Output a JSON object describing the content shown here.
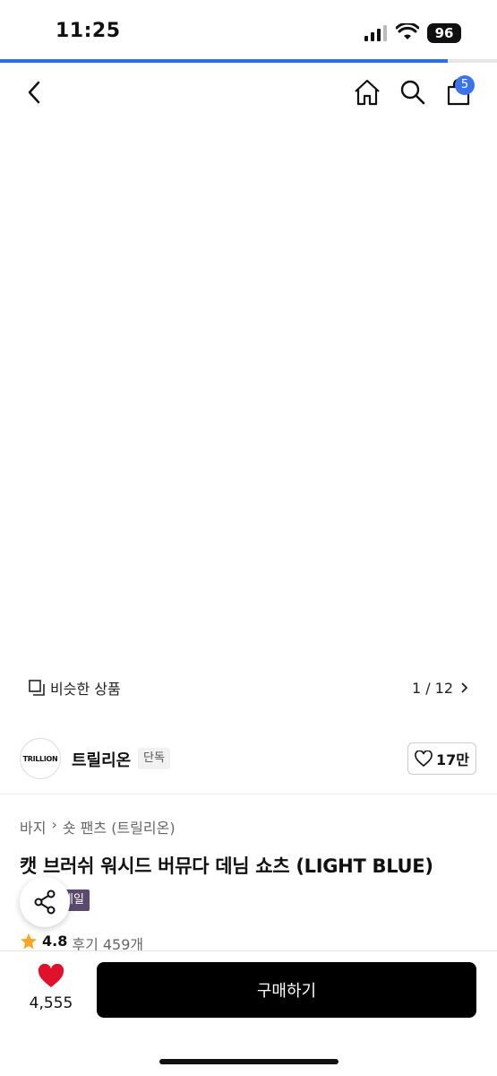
{
  "status_bar": {
    "time": "11:25",
    "battery": "96"
  },
  "load_progress": 0.9,
  "cart": {
    "count": "5"
  },
  "image": {
    "similar_label": "비슷한 상품",
    "counter": "1 / 12"
  },
  "brand": {
    "logo_text": "TRILLION",
    "name": "트릴리온",
    "badge": "단독",
    "likes": "17만"
  },
  "breadcrumb": [
    "바지",
    "숏 팬츠 (트릴리온)"
  ],
  "product": {
    "title": "캣 브러쉬 워시드 버뮤다 데님 쇼츠 (LIGHT BLUE)",
    "sale_tag": "세일",
    "rating": "4.8",
    "reviews": "후기 459개"
  },
  "bottom": {
    "wish_count": "4,555",
    "buy_label": "구매하기"
  },
  "colors": {
    "accent": "#2f6fe0",
    "badge": "#3a74e8",
    "heart": "#e0112b",
    "star": "#f5a623",
    "denim": "#7fa9c9"
  }
}
